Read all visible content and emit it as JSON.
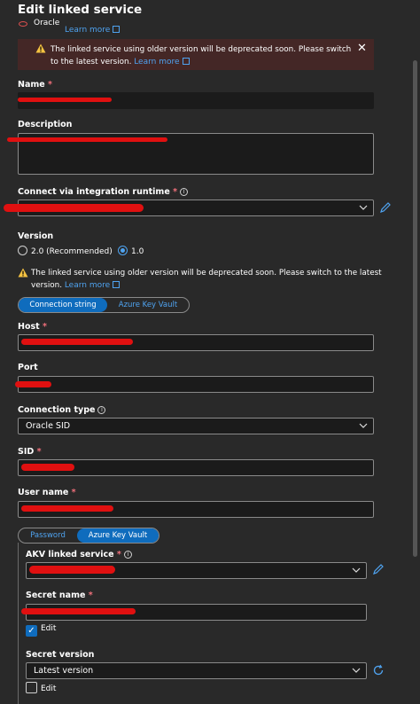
{
  "header": {
    "title": "Edit linked service",
    "service_type": "Oracle",
    "learn_more": "Learn more"
  },
  "banner": {
    "text": "The linked service using older version will be deprecated soon. Please switch to the latest version.",
    "learn_more": "Learn more"
  },
  "fields": {
    "name_label": "Name",
    "description_label": "Description",
    "runtime_label": "Connect via integration runtime",
    "version_label": "Version",
    "version_option_1": "2.0 (Recommended)",
    "version_option_2": "1.0",
    "version_selected": "1.0",
    "version_warning": "The linked service using older version will be deprecated soon. Please switch to the latest version.",
    "version_learn_more": "Learn more",
    "conn_tab_1": "Connection string",
    "conn_tab_2": "Azure Key Vault",
    "host_label": "Host",
    "port_label": "Port",
    "conn_type_label": "Connection type",
    "conn_type_value": "Oracle SID",
    "sid_label": "SID",
    "user_label": "User name",
    "pwd_tab_1": "Password",
    "pwd_tab_2": "Azure Key Vault",
    "akv_label": "AKV linked service",
    "secret_label": "Secret name",
    "secret_edit": "Edit",
    "secret_version_label": "Secret version",
    "secret_version_value": "Latest version",
    "version_edit": "Edit"
  },
  "colors": {
    "background": "#292929",
    "banner": "#442726",
    "accent": "#0f6cbd",
    "required": "#f1707b",
    "redaction": "#e01010"
  },
  "icons": [
    "oracle-icon",
    "external-link-icon",
    "warning-icon",
    "close-icon",
    "info-icon",
    "chevron-down-icon",
    "pencil-icon",
    "refresh-icon",
    "checkbox-icon"
  ]
}
